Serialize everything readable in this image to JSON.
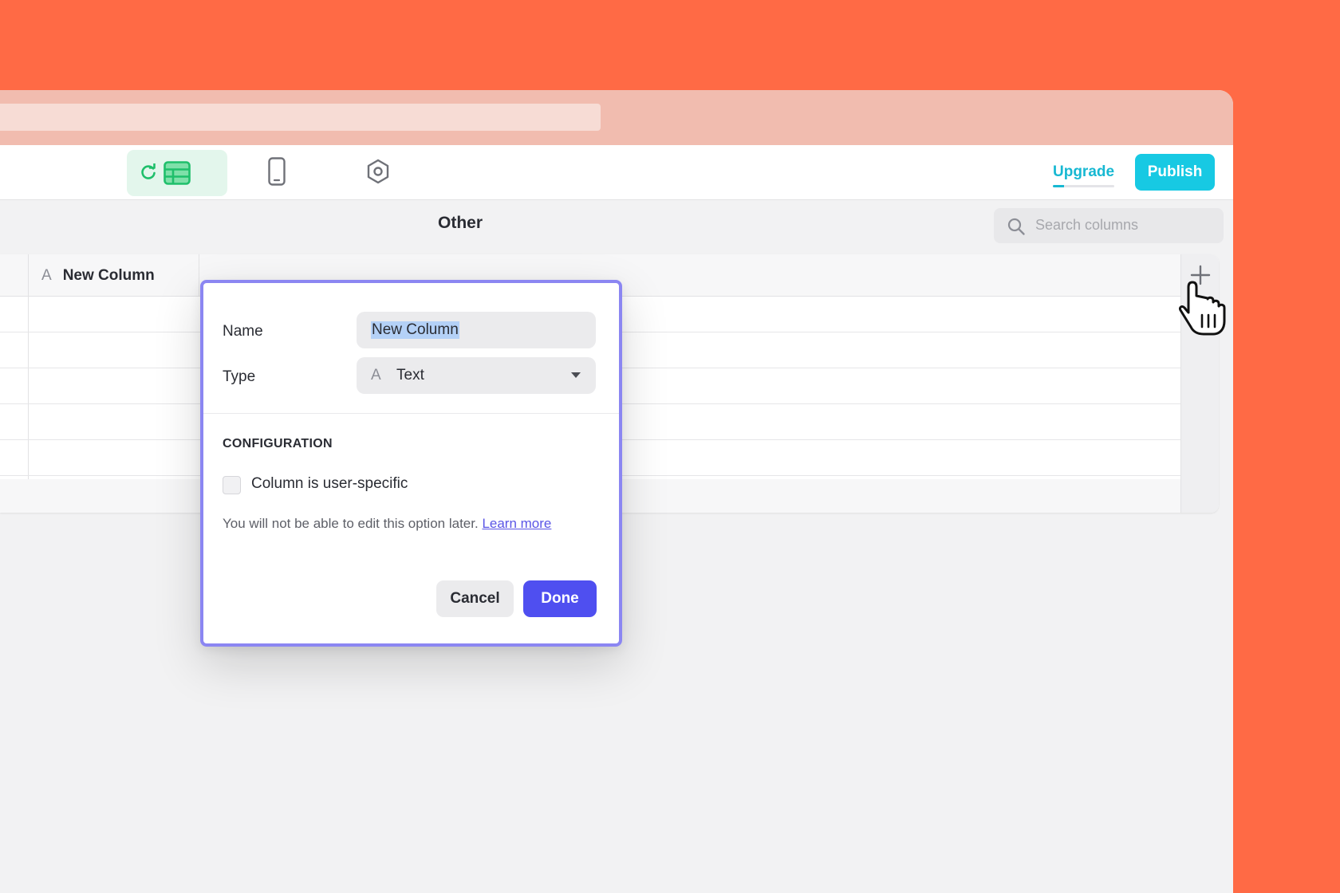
{
  "toolbar": {
    "tabs": [
      {
        "name": "data",
        "icon": "table-grid-icon",
        "active": true
      },
      {
        "name": "layout",
        "icon": "phone-icon",
        "active": false
      },
      {
        "name": "settings",
        "icon": "hexagon-settings-icon",
        "active": false
      }
    ],
    "upgrade_label": "Upgrade",
    "publish_label": "Publish"
  },
  "subheader": {
    "title": "Other",
    "search_placeholder": "Search columns"
  },
  "table": {
    "columns": [
      {
        "type_glyph": "A",
        "label": "New Column"
      }
    ]
  },
  "dialog": {
    "name_label": "Name",
    "name_value": "New Column",
    "type_label": "Type",
    "type_glyph": "A",
    "type_value": "Text",
    "section_title": "CONFIGURATION",
    "checkbox_label": "Column is user-specific",
    "checkbox_checked": false,
    "hint_text": "You will not be able to edit this option later.",
    "hint_link": "Learn more",
    "cancel_label": "Cancel",
    "done_label": "Done"
  },
  "colors": {
    "background": "#ff6a45",
    "accent_cyan": "#17c9e3",
    "primary_button": "#4f4ff0",
    "dialog_border": "#8b86f2",
    "data_tab_green": "#1fbf6b"
  }
}
